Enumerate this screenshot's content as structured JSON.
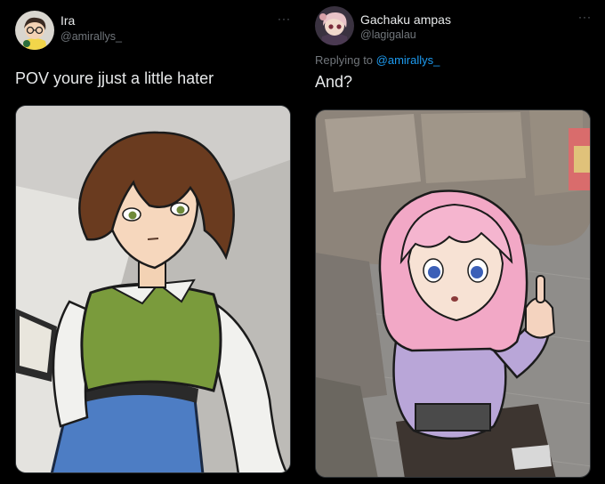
{
  "left_tweet": {
    "author_name": "Ira",
    "author_handle": "@amirallys_",
    "more_label": "···",
    "text": "POV youre jjust a little hater",
    "avatar_icon": "avatar-glasses-character",
    "image_desc_icon": "drawn-character-photo"
  },
  "right_tweet": {
    "author_name": "Gachaku ampas",
    "author_handle": "@lagigalau",
    "more_label": "···",
    "replying_to_prefix": "Replying to ",
    "replying_to_handle": "@amirallys_",
    "text": "And?",
    "avatar_icon": "avatar-anime-character",
    "image_desc_icon": "drawn-character-photo"
  },
  "colors": {
    "background": "#000000",
    "text": "#e7e9ea",
    "secondary": "#71767b",
    "link": "#1d9bf0"
  }
}
